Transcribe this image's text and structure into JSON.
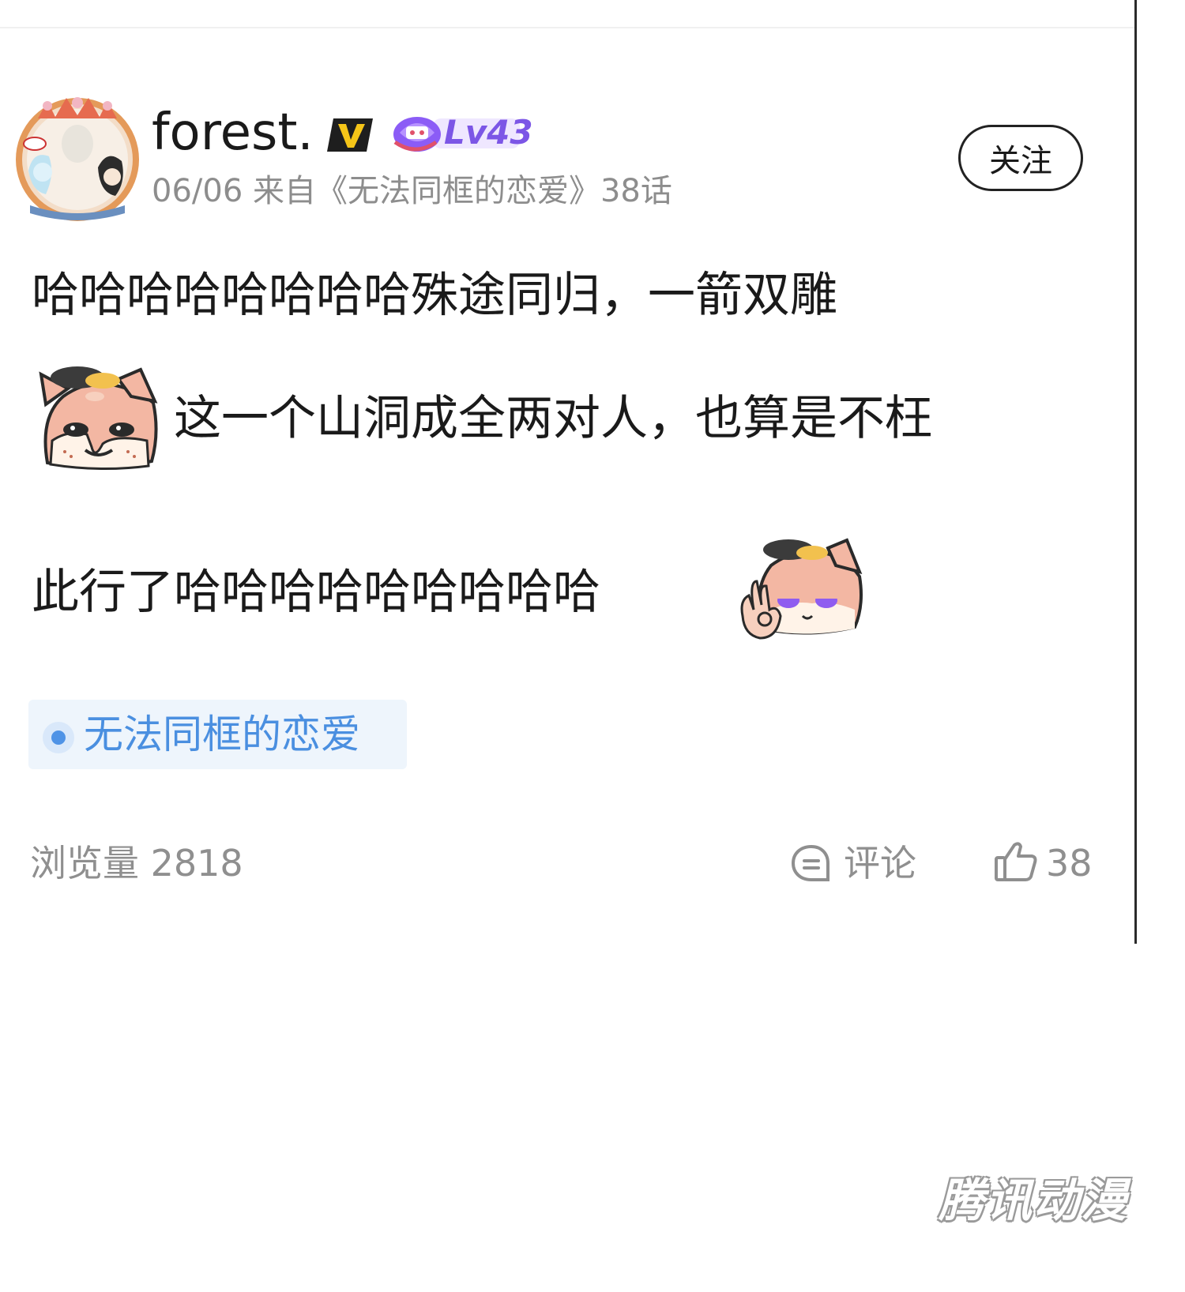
{
  "post": {
    "author": "forest.",
    "level": "Lv43",
    "meta": "06/06  来自《无法同框的恋爱》38话",
    "follow_label": "关注",
    "content": {
      "line1": "哈哈哈哈哈哈哈哈殊途同归，一箭双雕",
      "line2": "这一个山洞成全两对人，也算是不枉",
      "line3": "此行了哈哈哈哈哈哈哈哈哈"
    },
    "topic_tag": "无法同框的恋爱",
    "views": "浏览量 2818",
    "comment_label": "评论",
    "like_count": "38"
  },
  "watermark": "腾讯动漫",
  "colors": {
    "level_purple": "#7c56e6",
    "tag_blue": "#4a8fe0",
    "tag_bg": "#eef5fc",
    "meta_gray": "#8d8d8d",
    "badge_gold": "#f5c518"
  }
}
